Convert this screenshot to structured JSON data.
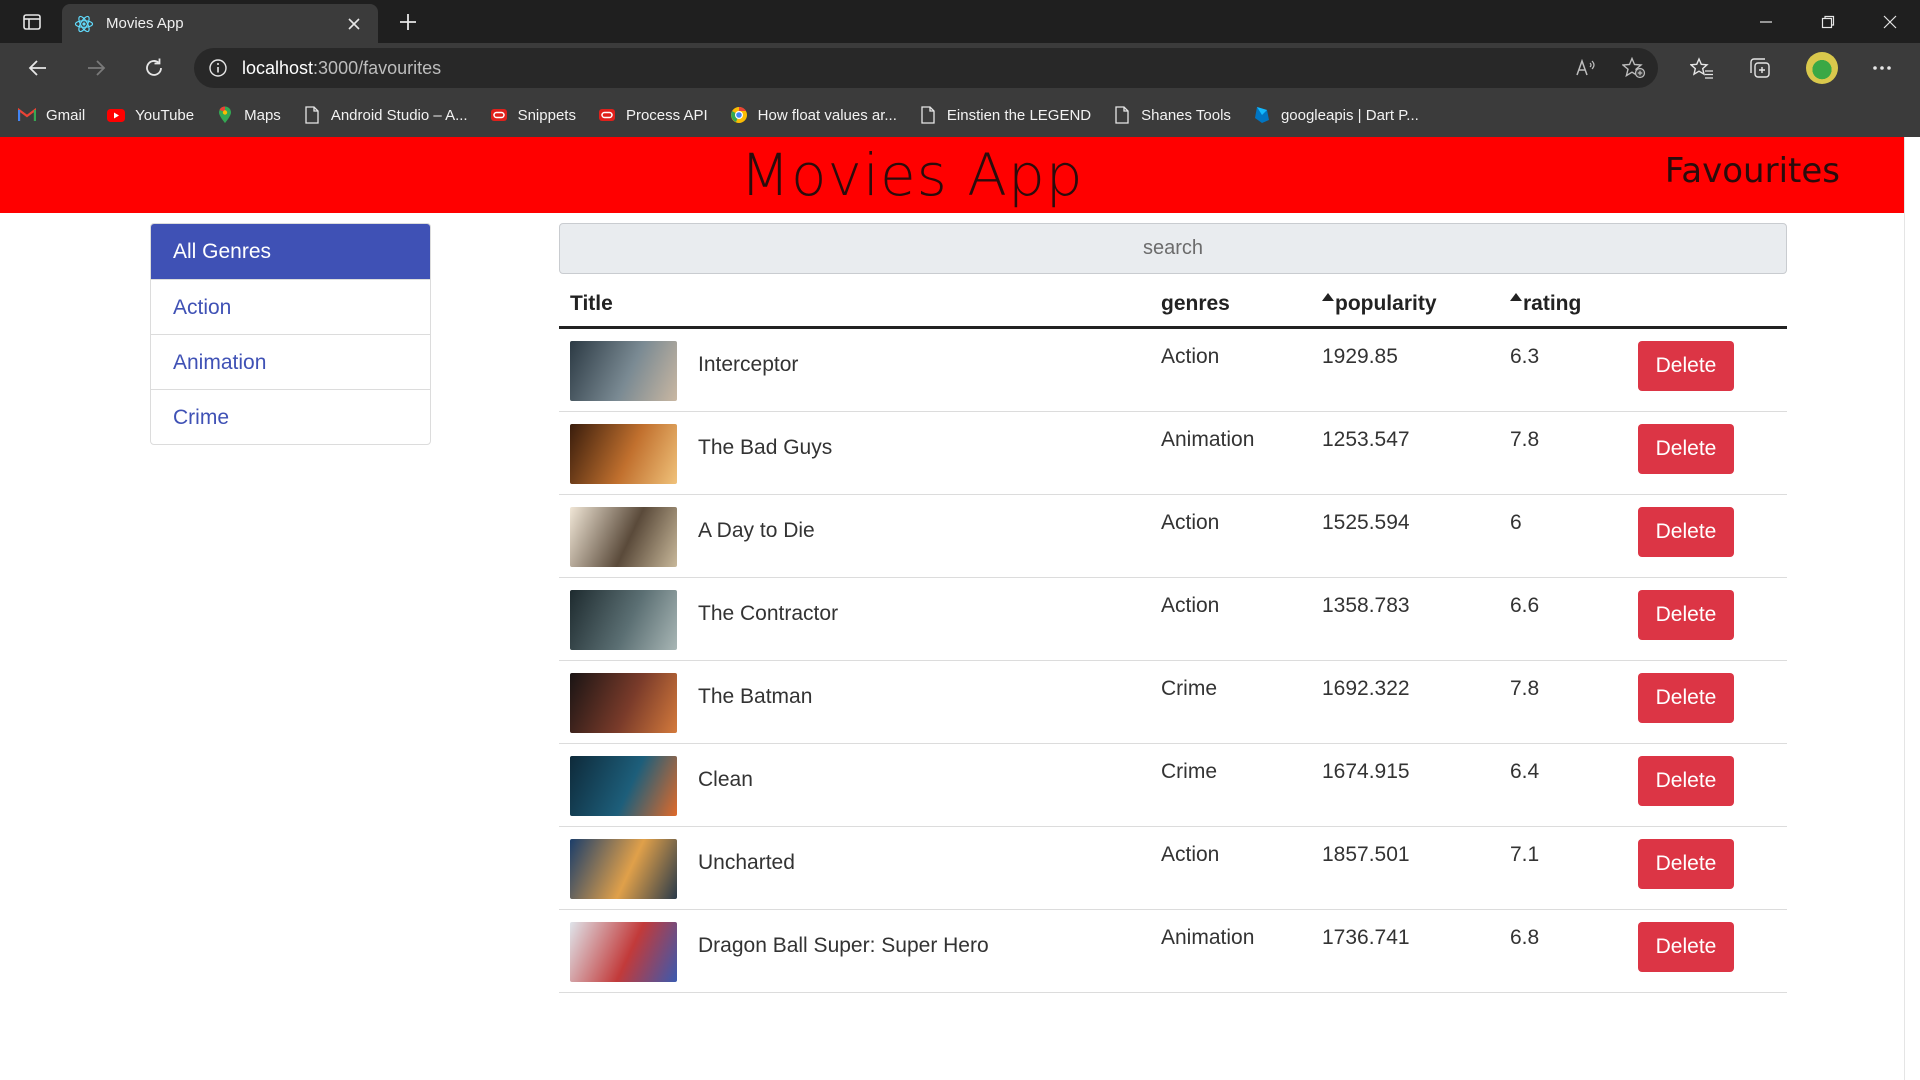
{
  "browser": {
    "tab_title": "Movies App",
    "url_host": "localhost",
    "url_rest": ":3000/favourites",
    "bookmarks": [
      {
        "label": "Gmail",
        "icon": "gmail-icon"
      },
      {
        "label": "YouTube",
        "icon": "youtube-icon"
      },
      {
        "label": "Maps",
        "icon": "maps-icon"
      },
      {
        "label": "Android Studio – A...",
        "icon": "page-icon"
      },
      {
        "label": "Snippets",
        "icon": "oracle-icon"
      },
      {
        "label": "Process API",
        "icon": "oracle-icon"
      },
      {
        "label": "How float values ar...",
        "icon": "chrome-icon"
      },
      {
        "label": "Einstien the LEGEND",
        "icon": "page-icon"
      },
      {
        "label": "Shanes Tools",
        "icon": "page-icon"
      },
      {
        "label": "googleapis | Dart P...",
        "icon": "dart-icon"
      }
    ]
  },
  "header": {
    "title": "Movies App",
    "favourites_link": "Favourites"
  },
  "genres": {
    "items": [
      "All Genres",
      "Action",
      "Animation",
      "Crime"
    ],
    "selected": "All Genres"
  },
  "search": {
    "placeholder": "search"
  },
  "table": {
    "columns": {
      "title": "Title",
      "genres": "genres",
      "popularity": "popularity",
      "rating": "rating"
    },
    "rows": [
      {
        "title": "Interceptor",
        "genre": "Action",
        "popularity": "1929.85",
        "rating": "6.3",
        "action": "Delete",
        "thumb": [
          "#2c3a44",
          "#7a8a93",
          "#c9b7a2"
        ]
      },
      {
        "title": "The Bad Guys",
        "genre": "Animation",
        "popularity": "1253.547",
        "rating": "7.8",
        "action": "Delete",
        "thumb": [
          "#3a1d0c",
          "#c1702e",
          "#f0c27a"
        ]
      },
      {
        "title": "A Day to Die",
        "genre": "Action",
        "popularity": "1525.594",
        "rating": "6",
        "action": "Delete",
        "thumb": [
          "#f0e6d6",
          "#5a4a3a",
          "#c8b89a"
        ]
      },
      {
        "title": "The Contractor",
        "genre": "Action",
        "popularity": "1358.783",
        "rating": "6.6",
        "action": "Delete",
        "thumb": [
          "#1e2b2f",
          "#5b6f73",
          "#a8b6b5"
        ]
      },
      {
        "title": "The Batman",
        "genre": "Crime",
        "popularity": "1692.322",
        "rating": "7.8",
        "action": "Delete",
        "thumb": [
          "#1a1414",
          "#7a3b2a",
          "#d47a3c"
        ]
      },
      {
        "title": "Clean",
        "genre": "Crime",
        "popularity": "1674.915",
        "rating": "6.4",
        "action": "Delete",
        "thumb": [
          "#0e2a3a",
          "#1d5e7a",
          "#e06a2a"
        ]
      },
      {
        "title": "Uncharted",
        "genre": "Action",
        "popularity": "1857.501",
        "rating": "7.1",
        "action": "Delete",
        "thumb": [
          "#1c3e6a",
          "#e0a04a",
          "#2a3a4a"
        ]
      },
      {
        "title": "Dragon Ball Super: Super Hero",
        "genre": "Animation",
        "popularity": "1736.741",
        "rating": "6.8",
        "action": "Delete",
        "thumb": [
          "#dfe4ea",
          "#c23a3a",
          "#3a5ab0"
        ]
      }
    ]
  },
  "colors": {
    "header_bg": "#ff0000",
    "genre_accent": "#3f51b5",
    "delete_bg": "#dc3545"
  }
}
